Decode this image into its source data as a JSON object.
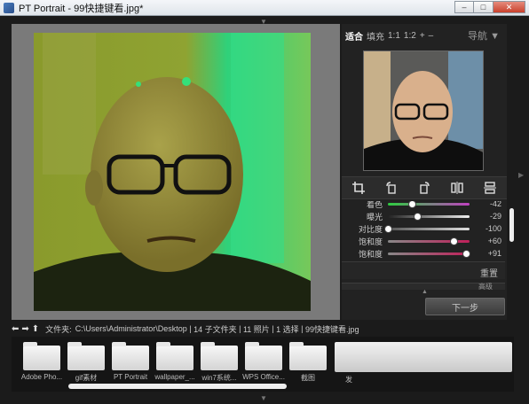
{
  "window": {
    "title": "PT Portrait - 99快捷键看.jpg*",
    "minimize": "–",
    "maximize": "□",
    "close": "✕"
  },
  "zoom": {
    "fit": "适合",
    "fill": "填充",
    "one_to_one": "1:1",
    "one_to_two": "1:2",
    "plus": "+",
    "minus": "–",
    "navigator": "导航 ▼"
  },
  "sliders": [
    {
      "label": "着色",
      "value": "-42",
      "fraction": 0.29
    },
    {
      "label": "曝光",
      "value": "-29",
      "fraction": 0.36
    },
    {
      "label": "对比度",
      "value": "-100",
      "fraction": 0.0
    },
    {
      "label": "饱和度",
      "value": "+60",
      "fraction": 0.8
    },
    {
      "label": "饱和度",
      "value": "+91",
      "fraction": 0.955
    }
  ],
  "reset_label": "重置",
  "advanced_label": "高级",
  "next_button": "下一步",
  "path": {
    "folder_label": "文件夹:",
    "path": "C:\\Users\\Administrator\\Desktop",
    "sub_folders": "14 子文件夹",
    "photos": "11 照片",
    "selected": "1 选择",
    "current": "99快捷键看.jpg"
  },
  "folders": [
    "Adobe Pho...",
    "gif素材",
    "PT Portrait",
    "wallpaper_...",
    "win7系统...",
    "WPS Office...",
    "截图"
  ],
  "big_folder_label": "发",
  "colors": {
    "accent_green": "#2ecc40",
    "panel_bg": "#222222"
  }
}
